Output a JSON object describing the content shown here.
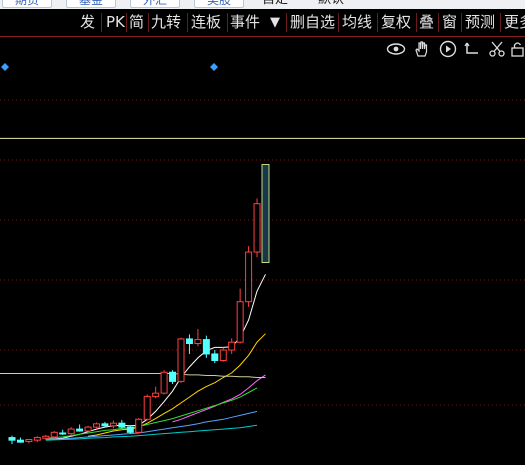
{
  "top_strip": {
    "buttons": [
      "期货",
      "基金",
      "外汇",
      "美股"
    ],
    "texts": [
      "自定",
      "默认"
    ]
  },
  "toolbar": {
    "items": [
      "发",
      "PK",
      "简",
      "九转",
      "连板",
      "事件",
      "▼",
      "删自选",
      "均线",
      "复权",
      "叠",
      "窗",
      "预测",
      "更多"
    ]
  },
  "icon_row": {
    "icons": [
      "eye-icon",
      "hand-icon",
      "play-circle-icon",
      "undo-icon",
      "scissors-icon",
      "lock-icon"
    ]
  },
  "colors": {
    "up": "#ff4040",
    "down": "#54ffff",
    "grid": "#7a1414",
    "toolbar_border": "#8a1e1e",
    "marker": "#3aa0ff",
    "limit_line": "#e9e9a0"
  },
  "chart_data": {
    "type": "candlestick",
    "candles": [
      {
        "o": 10.2,
        "h": 10.5,
        "l": 9.2,
        "c": 9.8
      },
      {
        "o": 9.8,
        "h": 10.2,
        "l": 9.4,
        "c": 9.5
      },
      {
        "o": 9.6,
        "h": 10.0,
        "l": 9.3,
        "c": 9.9
      },
      {
        "o": 9.8,
        "h": 10.4,
        "l": 9.5,
        "c": 10.2
      },
      {
        "o": 10.1,
        "h": 10.6,
        "l": 9.9,
        "c": 10.4
      },
      {
        "o": 10.3,
        "h": 11.2,
        "l": 10.1,
        "c": 11.0
      },
      {
        "o": 10.9,
        "h": 11.4,
        "l": 10.6,
        "c": 10.8
      },
      {
        "o": 10.8,
        "h": 11.8,
        "l": 10.6,
        "c": 11.5
      },
      {
        "o": 11.5,
        "h": 12.2,
        "l": 11.1,
        "c": 11.2
      },
      {
        "o": 11.2,
        "h": 12.0,
        "l": 11.0,
        "c": 11.8
      },
      {
        "o": 11.8,
        "h": 12.5,
        "l": 11.5,
        "c": 12.3
      },
      {
        "o": 12.3,
        "h": 12.6,
        "l": 11.9,
        "c": 12.0
      },
      {
        "o": 12.0,
        "h": 12.8,
        "l": 11.6,
        "c": 12.4
      },
      {
        "o": 12.4,
        "h": 12.9,
        "l": 11.6,
        "c": 11.8
      },
      {
        "o": 11.8,
        "h": 12.0,
        "l": 10.8,
        "c": 11.0
      },
      {
        "o": 11.0,
        "h": 13.2,
        "l": 10.8,
        "c": 13.0
      },
      {
        "o": 13.0,
        "h": 16.8,
        "l": 12.8,
        "c": 16.5
      },
      {
        "o": 16.5,
        "h": 18.0,
        "l": 16.2,
        "c": 17.0
      },
      {
        "o": 17.0,
        "h": 20.5,
        "l": 16.8,
        "c": 20.2
      },
      {
        "o": 20.2,
        "h": 20.5,
        "l": 18.4,
        "c": 18.8
      },
      {
        "o": 18.8,
        "h": 25.5,
        "l": 18.6,
        "c": 25.3
      },
      {
        "o": 25.3,
        "h": 26.0,
        "l": 23.0,
        "c": 24.6
      },
      {
        "o": 24.6,
        "h": 26.8,
        "l": 24.2,
        "c": 25.2
      },
      {
        "o": 25.2,
        "h": 25.8,
        "l": 22.4,
        "c": 23.0
      },
      {
        "o": 23.0,
        "h": 23.6,
        "l": 21.6,
        "c": 22.0
      },
      {
        "o": 22.0,
        "h": 24.0,
        "l": 21.8,
        "c": 23.6
      },
      {
        "o": 23.6,
        "h": 25.4,
        "l": 23.0,
        "c": 24.8
      },
      {
        "o": 24.8,
        "h": 33.0,
        "l": 24.6,
        "c": 31.0
      },
      {
        "o": 31.0,
        "h": 39.5,
        "l": 30.2,
        "c": 38.6
      },
      {
        "o": 38.6,
        "h": 46.8,
        "l": 37.8,
        "c": 46.0
      },
      {
        "o": 44.0,
        "h": 52.0,
        "l": 37.0,
        "c": 37.0
      }
    ],
    "ma_series": [
      {
        "color": "#ffffff",
        "values": [
          null,
          null,
          null,
          null,
          9.9,
          10.0,
          10.1,
          10.4,
          10.7,
          11.1,
          11.5,
          11.8,
          12.0,
          12.1,
          12.0,
          12.1,
          13.0,
          14.2,
          15.7,
          17.3,
          19.4,
          21.0,
          22.4,
          23.5,
          24.0,
          24.0,
          24.1,
          25.5,
          28.2,
          32.6,
          35.2
        ]
      },
      {
        "color": "#ffd700",
        "values": [
          null,
          null,
          null,
          null,
          null,
          null,
          null,
          null,
          null,
          10.4,
          10.6,
          10.9,
          11.2,
          11.4,
          11.5,
          11.8,
          12.4,
          13.1,
          13.9,
          14.6,
          15.5,
          16.4,
          17.3,
          18.0,
          18.6,
          19.4,
          20.1,
          21.3,
          22.8,
          24.8,
          26.1
        ]
      },
      {
        "color": "#ff66ff",
        "values": [
          null,
          null,
          null,
          null,
          null,
          null,
          null,
          null,
          null,
          null,
          null,
          null,
          null,
          null,
          null,
          null,
          null,
          null,
          null,
          12.6,
          13.0,
          13.5,
          14.0,
          14.5,
          15.0,
          15.6,
          16.1,
          16.8,
          17.8,
          18.9,
          19.8
        ]
      },
      {
        "color": "#33dd33",
        "values": [
          null,
          null,
          null,
          null,
          10.1,
          10.2,
          10.3,
          10.5,
          10.7,
          10.9,
          11.1,
          11.3,
          11.4,
          11.6,
          11.7,
          11.9,
          12.2,
          12.5,
          12.8,
          13.1,
          13.5,
          13.9,
          14.3,
          14.7,
          15.1,
          15.5,
          15.9,
          16.4,
          17.1,
          17.8,
          null
        ]
      },
      {
        "color": "#5aa0ff",
        "values": [
          null,
          null,
          null,
          null,
          9.9,
          9.95,
          10.0,
          10.1,
          10.2,
          10.3,
          10.4,
          10.5,
          10.6,
          10.7,
          10.8,
          10.9,
          11.1,
          11.3,
          11.5,
          11.7,
          11.9,
          12.1,
          12.3,
          12.6,
          12.8,
          13.0,
          13.3,
          13.6,
          13.9,
          14.2,
          null
        ]
      },
      {
        "color": "#00cccc",
        "values": [
          null,
          null,
          null,
          null,
          9.8,
          9.85,
          9.9,
          9.95,
          10.0,
          10.1,
          10.15,
          10.2,
          10.3,
          10.35,
          10.4,
          10.5,
          10.6,
          10.7,
          10.8,
          10.9,
          11.0,
          11.1,
          11.2,
          11.3,
          11.4,
          11.5,
          11.6,
          11.7,
          11.9,
          12.1,
          null
        ]
      },
      {
        "color": "#cccc99",
        "values": [
          null,
          null,
          null,
          null,
          null,
          null,
          null,
          null,
          null,
          null,
          null,
          null,
          null,
          null,
          null,
          null,
          20.0,
          20.0,
          20.0,
          20.0,
          19.9,
          19.8,
          19.8,
          19.7,
          19.7,
          19.6,
          19.6,
          19.5,
          19.5,
          19.4,
          19.4
        ]
      }
    ],
    "level_line": 20.0,
    "limit_line": 56.0,
    "ylim": [
      6,
      68
    ]
  }
}
